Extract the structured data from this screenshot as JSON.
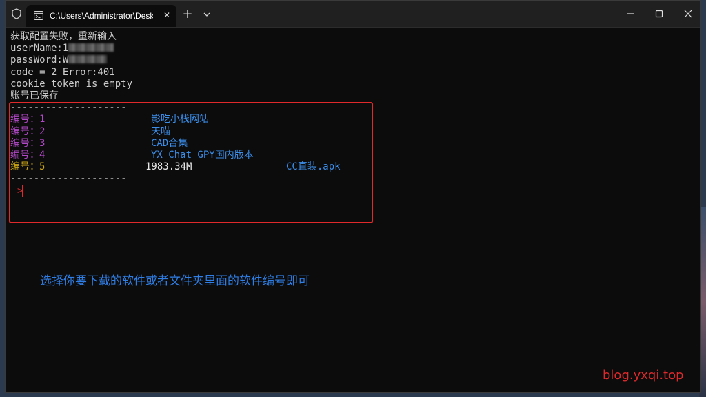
{
  "window": {
    "tab_title": "C:\\Users\\Administrator\\Deskto",
    "tab_close": "✕",
    "new_tab": "+"
  },
  "terminal": {
    "lines": [
      "获取配置失败，重新输入",
      "userName:1",
      "passWord:W",
      "code = 2 Error:401",
      "cookie token is empty",
      "账号已保存",
      "--------------------"
    ],
    "items": [
      {
        "label": "编号：",
        "number": "1",
        "name": "影吃小栈网站",
        "size": ""
      },
      {
        "label": "编号：",
        "number": "2",
        "name": "天喵",
        "size": ""
      },
      {
        "label": "编号：",
        "number": "3",
        "name": "CAD合集",
        "size": ""
      },
      {
        "label": "编号：",
        "number": "4",
        "name": "YX Chat GPY国内版本",
        "size": ""
      },
      {
        "label": "编号：",
        "number": "5",
        "name": "CC直装.apk",
        "size": "1983.34M"
      }
    ],
    "separator_bottom": "--------------------",
    "prompt": ">"
  },
  "annotation": "选择你要下载的软件或者文件夹里面的软件编号即可",
  "watermark": "blog.yxqi.top",
  "colors": {
    "folder_item": "#b148c6",
    "file_item": "#c9a415",
    "item_name": "#3b8eea",
    "highlight_box": "#e0292b"
  }
}
